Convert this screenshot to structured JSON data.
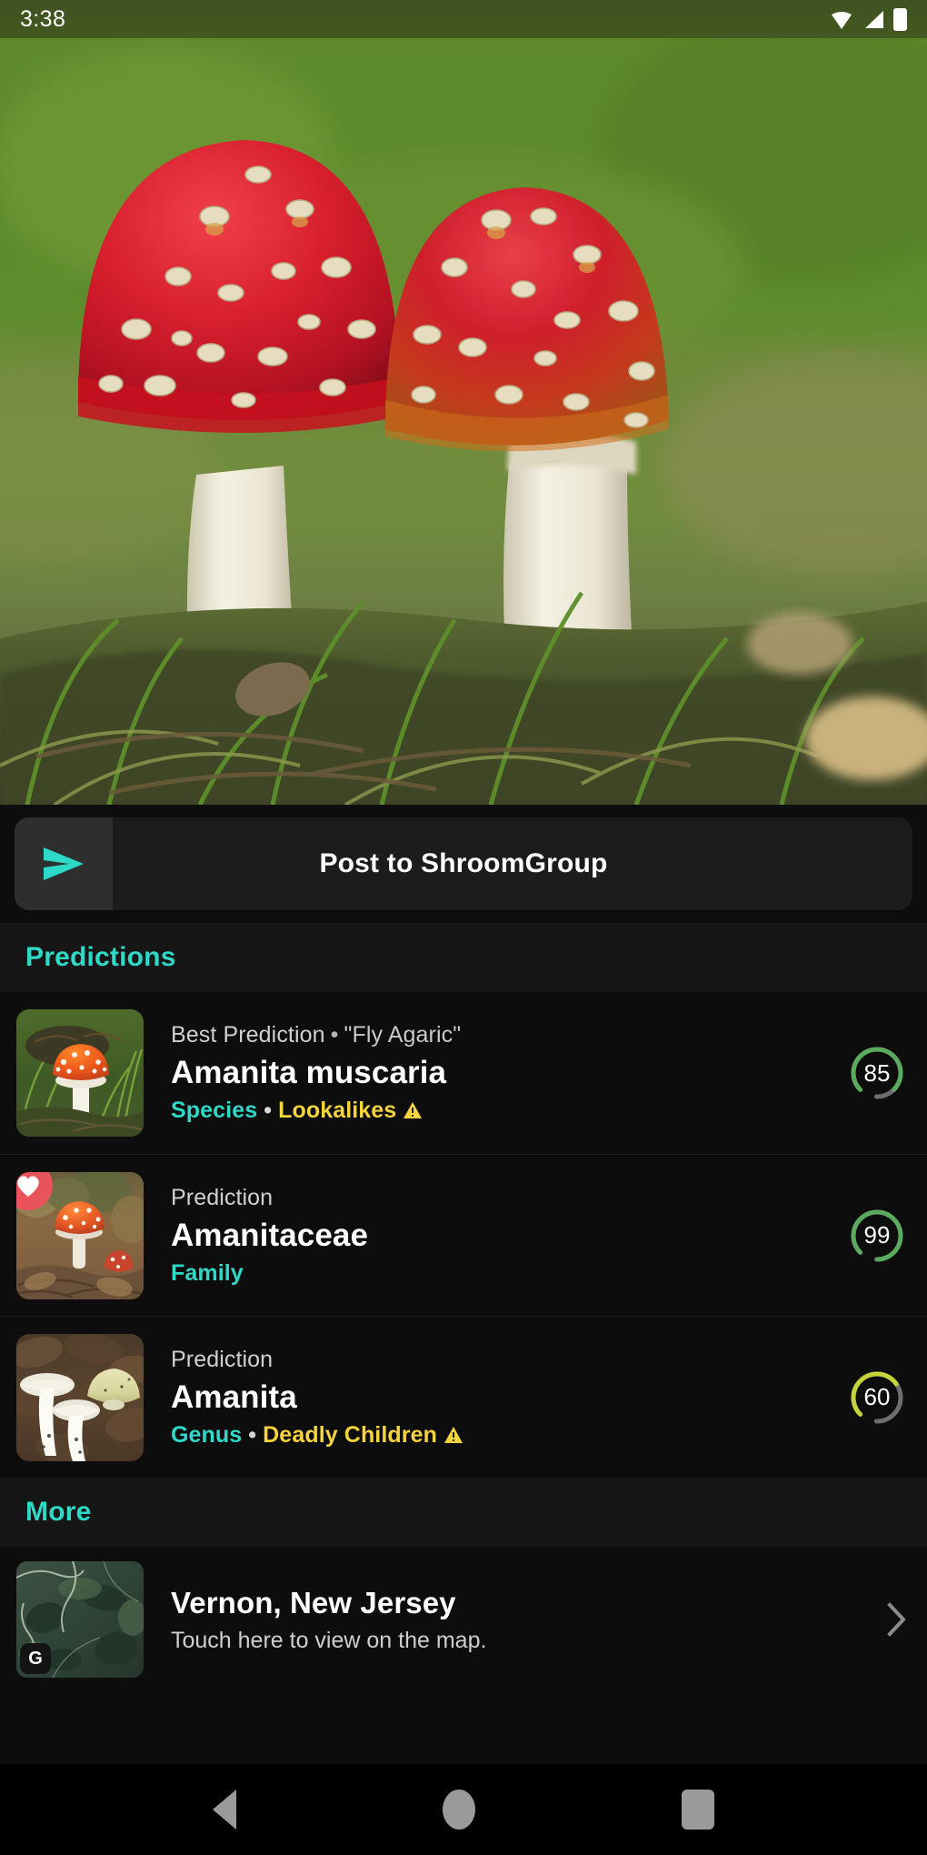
{
  "status_bar": {
    "time": "3:38",
    "icons": [
      "wifi-icon",
      "signal-icon",
      "battery-icon"
    ]
  },
  "hero": {
    "alt": "Two red fly agaric mushrooms with white warts in green grass",
    "icon": "mushroom-photo"
  },
  "post_button": {
    "label": "Post to ShroomGroup",
    "icon": "send-icon",
    "icon_color": "#2fd9c8"
  },
  "sections": {
    "predictions_header": "Predictions",
    "more_header": "More"
  },
  "predictions": [
    {
      "kicker": "Best Prediction",
      "kicker_separator": "•",
      "common_name": "\"Fly Agaric\"",
      "title": "Amanita muscaria",
      "rank": "Species",
      "meta_separator": "•",
      "warning": "Lookalikes",
      "warning_icon": "warning-triangle-icon",
      "score": 85,
      "score_color": "#5aab5d",
      "favorited": false,
      "thumb": "amanita-muscaria-thumb"
    },
    {
      "kicker": "Prediction",
      "kicker_separator": "",
      "common_name": "",
      "title": "Amanitaceae",
      "rank": "Family",
      "meta_separator": "",
      "warning": "",
      "warning_icon": "",
      "score": 99,
      "score_color": "#5aab5d",
      "favorited": true,
      "favorite_icon": "heart-icon",
      "favorite_color": "#e8535c",
      "thumb": "amanitaceae-thumb"
    },
    {
      "kicker": "Prediction",
      "kicker_separator": "",
      "common_name": "",
      "title": "Amanita",
      "rank": "Genus",
      "meta_separator": "•",
      "warning": "Deadly Children",
      "warning_icon": "warning-triangle-icon",
      "score": 60,
      "score_color": "#c4d339",
      "favorited": false,
      "thumb": "amanita-genus-thumb"
    }
  ],
  "more": {
    "location_title": "Vernon, New Jersey",
    "location_subtitle": "Touch here to view on the map.",
    "map_attribution": "G",
    "chevron": "chevron-right-icon",
    "thumb": "satellite-map-thumb"
  },
  "nav_bar": {
    "back": "back-icon",
    "home": "home-icon",
    "recents": "recents-icon"
  },
  "colors": {
    "accent_teal": "#2fd9c8",
    "warning_yellow": "#f5d33c",
    "score_green": "#5aab5d",
    "score_yellowgreen": "#c4d339",
    "heart_red": "#e8535c",
    "bg": "#0d0d0d",
    "section_bg": "#161616"
  }
}
